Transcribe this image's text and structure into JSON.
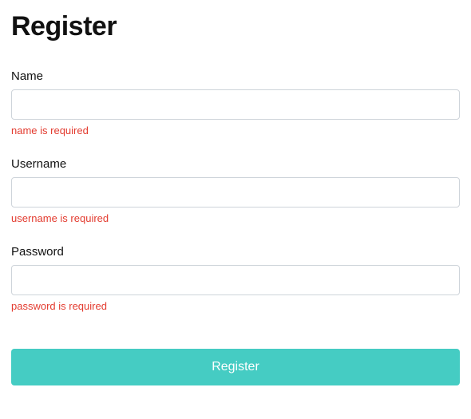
{
  "page": {
    "title": "Register"
  },
  "form": {
    "fields": {
      "name": {
        "label": "Name",
        "value": "",
        "error": "name is required"
      },
      "username": {
        "label": "Username",
        "value": "",
        "error": "username is required"
      },
      "password": {
        "label": "Password",
        "value": "",
        "error": "password is required"
      }
    },
    "submit_label": "Register"
  }
}
